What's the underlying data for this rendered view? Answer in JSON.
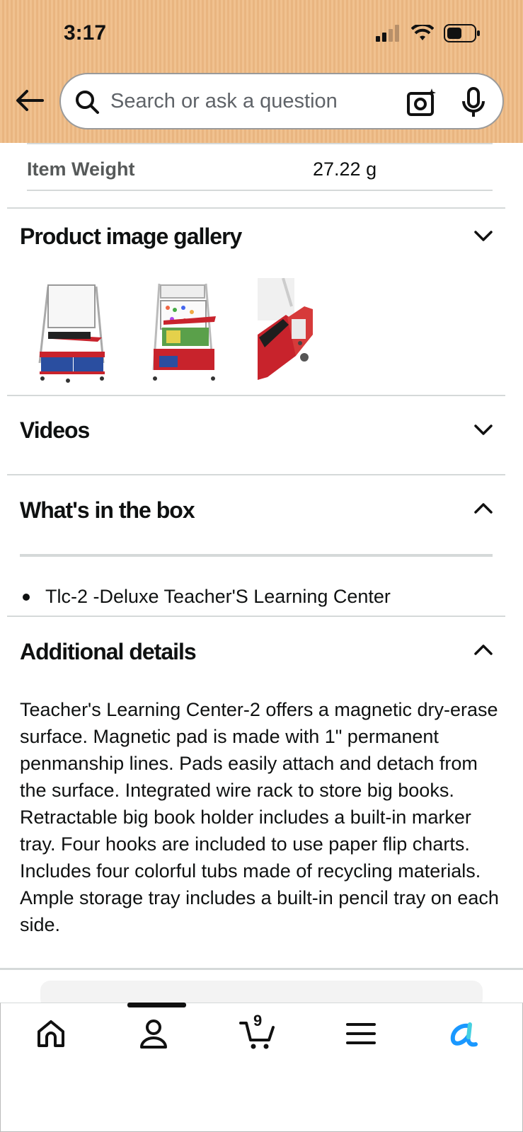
{
  "status_bar": {
    "time": "3:17"
  },
  "search": {
    "placeholder": "Search or ask a question"
  },
  "specs": {
    "item_weight_label": "Item Weight",
    "item_weight_value": "27.22 g"
  },
  "sections": {
    "gallery_title": "Product image gallery",
    "videos_title": "Videos",
    "box_title": "What's in the box",
    "details_title": "Additional details"
  },
  "box_items": [
    "Tlc-2 -Deluxe Teacher'S Learning Center"
  ],
  "details_text": "Teacher's Learning Center-2 offers a magnetic dry-erase surface. Magnetic pad is made with 1\" permanent penmanship lines. Pads easily attach and detach from the surface. Integrated wire rack to store big books. Retractable big book holder includes a built-in marker tray. Four hooks are included to use paper flip charts. Includes four colorful tubs made of recycling materials. Ample storage tray includes a built-in pencil tray on each side.",
  "tabbar": {
    "cart_count": "9"
  },
  "icons": [
    "back-arrow-icon",
    "search-icon",
    "camera-icon",
    "mic-icon",
    "chevron-down-icon",
    "chevron-up-icon",
    "home-icon",
    "account-icon",
    "cart-icon",
    "menu-icon",
    "rufus-icon"
  ],
  "colors": {
    "header_bg": "#f0c18f",
    "rufus": "#1a98ff"
  }
}
